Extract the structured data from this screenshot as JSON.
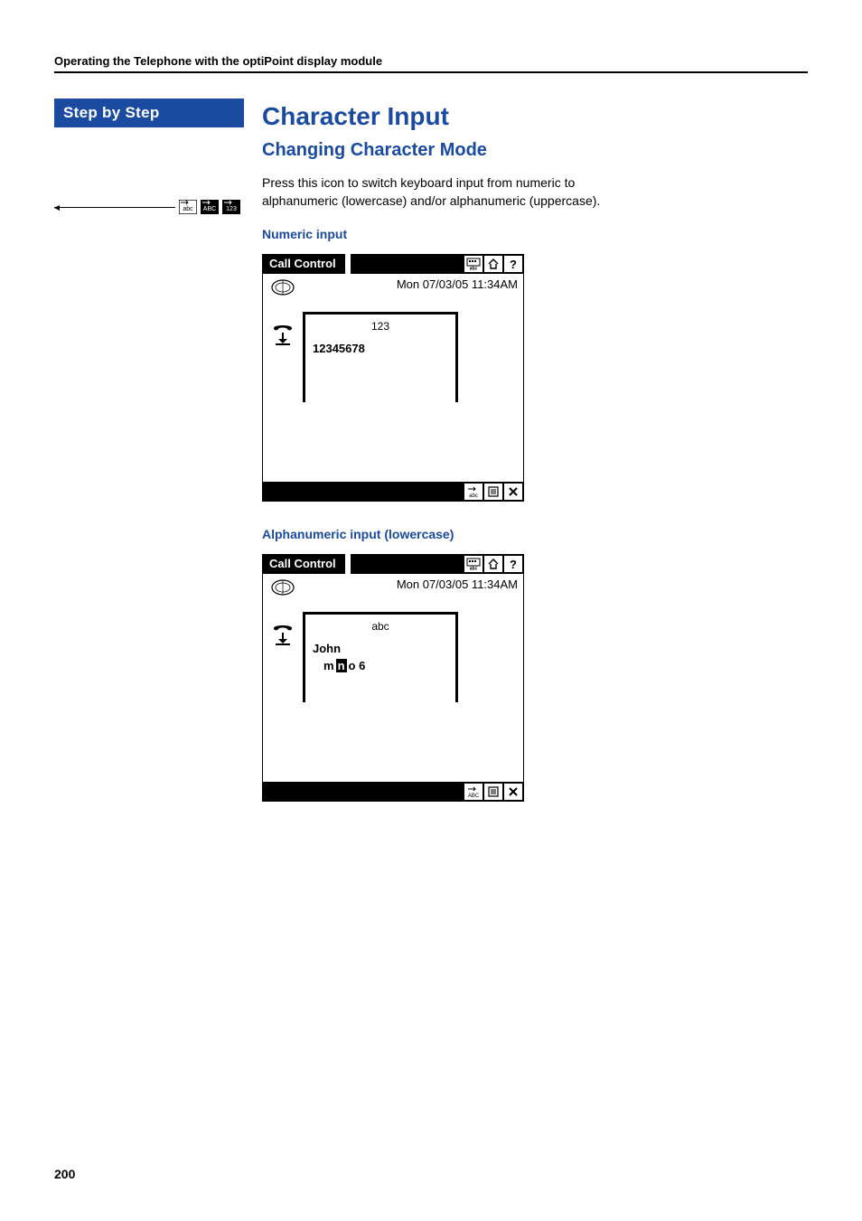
{
  "header": "Operating the Telephone with the optiPoint display module",
  "sidebar_label": "Step by Step",
  "section_title": "Character Input",
  "subsection_title": "Changing Character Mode",
  "body_paragraph": "Press this icon to switch keyboard input from numeric to alphanumeric (lowercase) and/or alphanumeric (uppercase).",
  "numeric_caption": "Numeric input",
  "alpha_caption": "Alphanumeric input (lowercase)",
  "screens": {
    "numeric": {
      "title": "Call Control",
      "datetime": "Mon 07/03/05 11:34AM",
      "mode": "123",
      "value": "12345678"
    },
    "alpha": {
      "title": "Call Control",
      "datetime": "Mon 07/03/05 11:34AM",
      "mode": "abc",
      "value_name": "John",
      "picker_before": "m",
      "picker_sel": "n",
      "picker_after": "o 6"
    }
  },
  "page_number": "200"
}
